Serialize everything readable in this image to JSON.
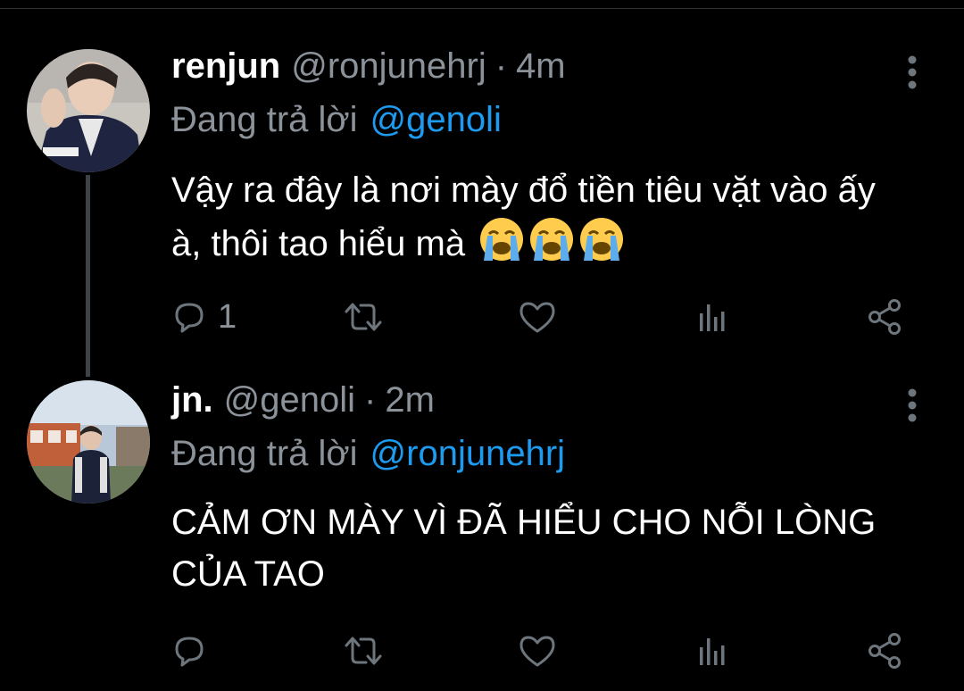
{
  "tweets": [
    {
      "display_name": "renjun",
      "handle": "@ronjunehrj",
      "separator": "·",
      "time": "4m",
      "reply_prefix": "Đang trả lời",
      "reply_to": "@genoli",
      "text": "Vậy ra đây là nơi mày đổ tiền tiêu vặt vào ấy à, thôi tao hiểu mà",
      "emojis": [
        "loudly-crying-face",
        "loudly-crying-face",
        "loudly-crying-face"
      ],
      "reply_count": "1",
      "retweet_count": "",
      "like_count": ""
    },
    {
      "display_name": "jn.",
      "handle": "@genoli",
      "separator": "·",
      "time": "2m",
      "reply_prefix": "Đang trả lời",
      "reply_to": "@ronjunehrj",
      "text": "CẢM ƠN MÀY VÌ ĐÃ HIỂU CHO NỖI LÒNG CỦA TAO",
      "emojis": [],
      "reply_count": "",
      "retweet_count": "",
      "like_count": ""
    }
  ],
  "icons": {
    "reply": "reply-icon",
    "retweet": "retweet-icon",
    "like": "heart-icon",
    "stats": "analytics-icon",
    "share": "share-icon",
    "more": "more-vertical-icon"
  },
  "colors": {
    "background": "#000000",
    "text": "#ffffff",
    "secondary": "#8b9299",
    "link": "#1d9bf0",
    "icon": "#6e767d",
    "thread_line": "#3d4247"
  }
}
